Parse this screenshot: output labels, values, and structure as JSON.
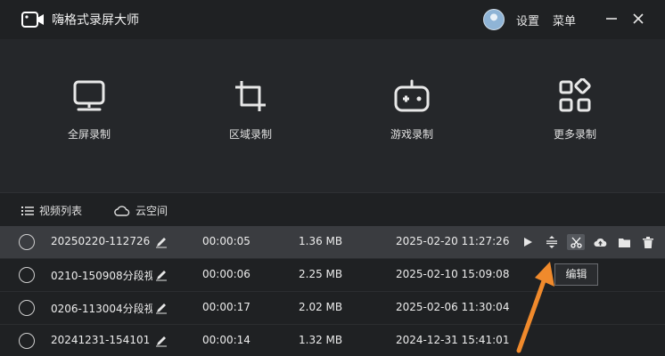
{
  "app": {
    "title": "嗨格式录屏大师"
  },
  "titlebar": {
    "settings_label": "设置",
    "menu_label": "菜单"
  },
  "modes": [
    {
      "label": "全屏录制",
      "icon": "monitor-icon"
    },
    {
      "label": "区域录制",
      "icon": "crop-icon"
    },
    {
      "label": "游戏录制",
      "icon": "gamepad-icon"
    },
    {
      "label": "更多录制",
      "icon": "grid-icon"
    }
  ],
  "tabs": {
    "video_list": "视频列表",
    "cloud_space": "云空间"
  },
  "rows": [
    {
      "name": "20250220-112726",
      "duration": "00:00:05",
      "size": "1.36 MB",
      "date": "2025-02-20 11:27:26"
    },
    {
      "name": "0210-150908分段视",
      "duration": "00:00:06",
      "size": "2.25 MB",
      "date": "2025-02-10 15:09:08"
    },
    {
      "name": "0206-113004分段视",
      "duration": "00:00:17",
      "size": "2.02 MB",
      "date": "2025-02-06 11:30:04"
    },
    {
      "name": "20241231-154101",
      "duration": "00:00:14",
      "size": "1.32 MB",
      "date": "2024-12-31 15:41:01"
    }
  ],
  "row_actions": [
    "play-icon",
    "split-icon",
    "edit-scissors-icon",
    "cloud-upload-icon",
    "folder-icon",
    "trash-icon"
  ],
  "tooltip": {
    "text": "编辑"
  },
  "colors": {
    "accent_arrow": "#f08a2c",
    "background": "#1f2123",
    "panel": "#25272a",
    "selected_row": "#3a3c40"
  }
}
